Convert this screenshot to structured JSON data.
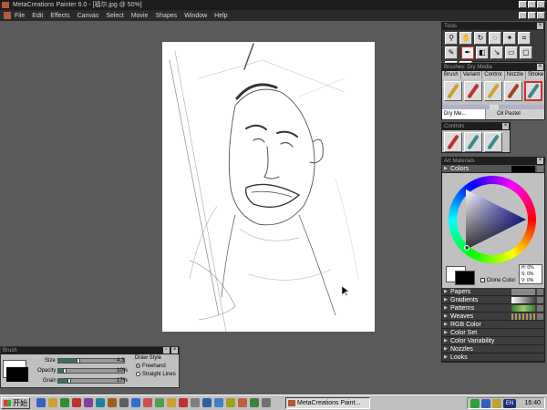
{
  "window": {
    "title": "MetaCreations Painter 6.0 - [福尔.jpg @ 50%]",
    "min": "_",
    "max": "□",
    "close": "×"
  },
  "menu": {
    "items": [
      "File",
      "Edit",
      "Effects",
      "Canvas",
      "Select",
      "Movie",
      "Shapes",
      "Window",
      "Help"
    ]
  },
  "tools_palette": {
    "title": "Tools"
  },
  "brushes_palette": {
    "title": "Brushes: Dry Media",
    "tabs": [
      "Brush",
      "Variant",
      "Control",
      "Nozzle",
      "Stroke"
    ],
    "category": "Dry Me...",
    "variant": "Oil Pastel"
  },
  "controls_palette": {
    "title": "Controls"
  },
  "art_materials": {
    "title": "Art Materials",
    "colors_label": "Colors",
    "clone_color": "Clone Color",
    "hsv": {
      "h": "H: 0%",
      "s": "S: 0%",
      "v": "V: 0%"
    },
    "sections": [
      "Papers",
      "Gradients",
      "Patterns",
      "Weaves",
      "RGB Color",
      "Color Set",
      "Color Variability",
      "Nozzles",
      "Looks"
    ]
  },
  "brush_controls": {
    "title": "Brush",
    "size_label": "Size",
    "size_value": "4.3",
    "size_level": 0.3,
    "opacity_label": "Opacity",
    "opacity_value": "10%",
    "opacity_level": 0.1,
    "grain_label": "Grain",
    "grain_value": "17%",
    "grain_level": 0.17,
    "draw_style_label": "Draw Style",
    "freehand": "Freehand",
    "straight_lines": "Straight Lines"
  },
  "taskbar": {
    "start_label": "开始",
    "task_button": "MetaCreations Paint...",
    "clock": "16:40",
    "tray_lang": "EN"
  },
  "colors": {
    "accent_red": "#d03030",
    "hue_blue": "#2020d0"
  }
}
